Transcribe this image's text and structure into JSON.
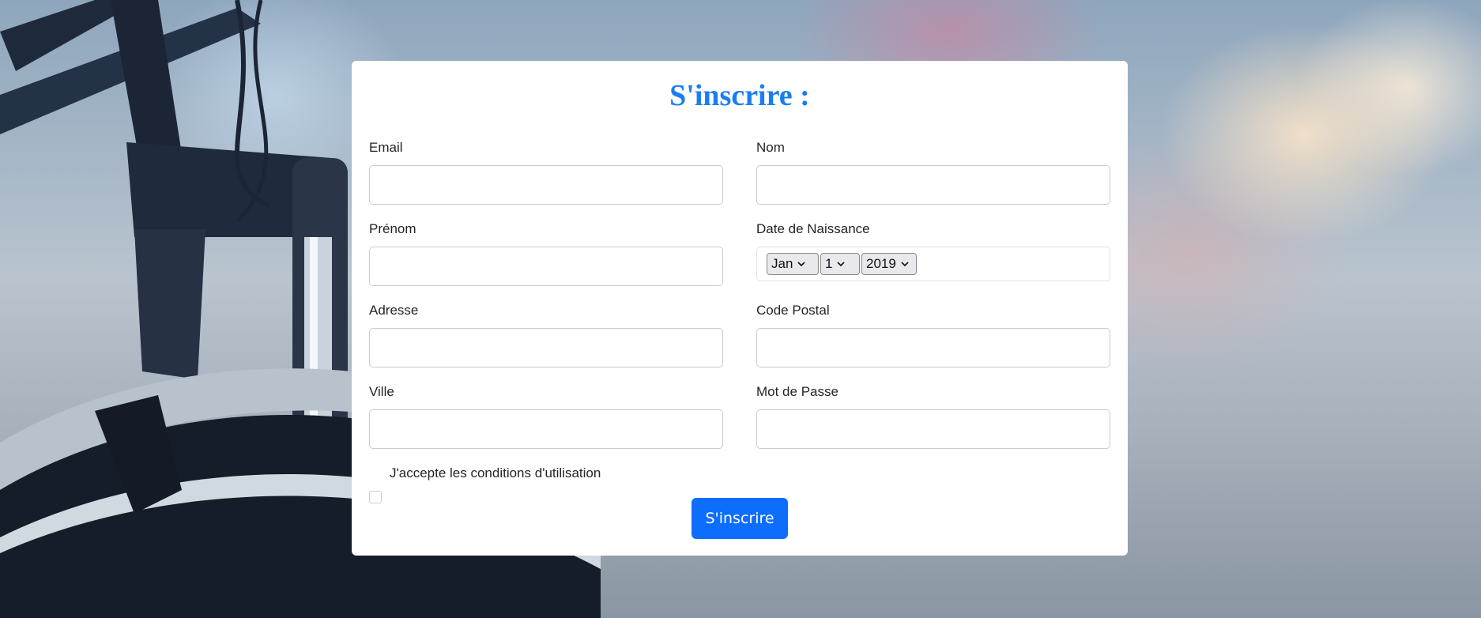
{
  "form": {
    "title": "S'inscrire :",
    "fields": {
      "email": {
        "label": "Email",
        "value": ""
      },
      "nom": {
        "label": "Nom",
        "value": ""
      },
      "prenom": {
        "label": "Prénom",
        "value": ""
      },
      "date_naissance": {
        "label": "Date de Naissance",
        "month": "Jan",
        "day": "1",
        "year": "2019"
      },
      "adresse": {
        "label": "Adresse",
        "value": ""
      },
      "code_postal": {
        "label": "Code Postal",
        "value": ""
      },
      "ville": {
        "label": "Ville",
        "value": ""
      },
      "mot_de_passe": {
        "label": "Mot de Passe",
        "value": ""
      }
    },
    "terms_label": "J'accepte les conditions d'utilisation",
    "terms_checked": false,
    "submit_label": "S'inscrire"
  },
  "colors": {
    "title": "#1a7ef0",
    "button": "#0d6efd"
  }
}
